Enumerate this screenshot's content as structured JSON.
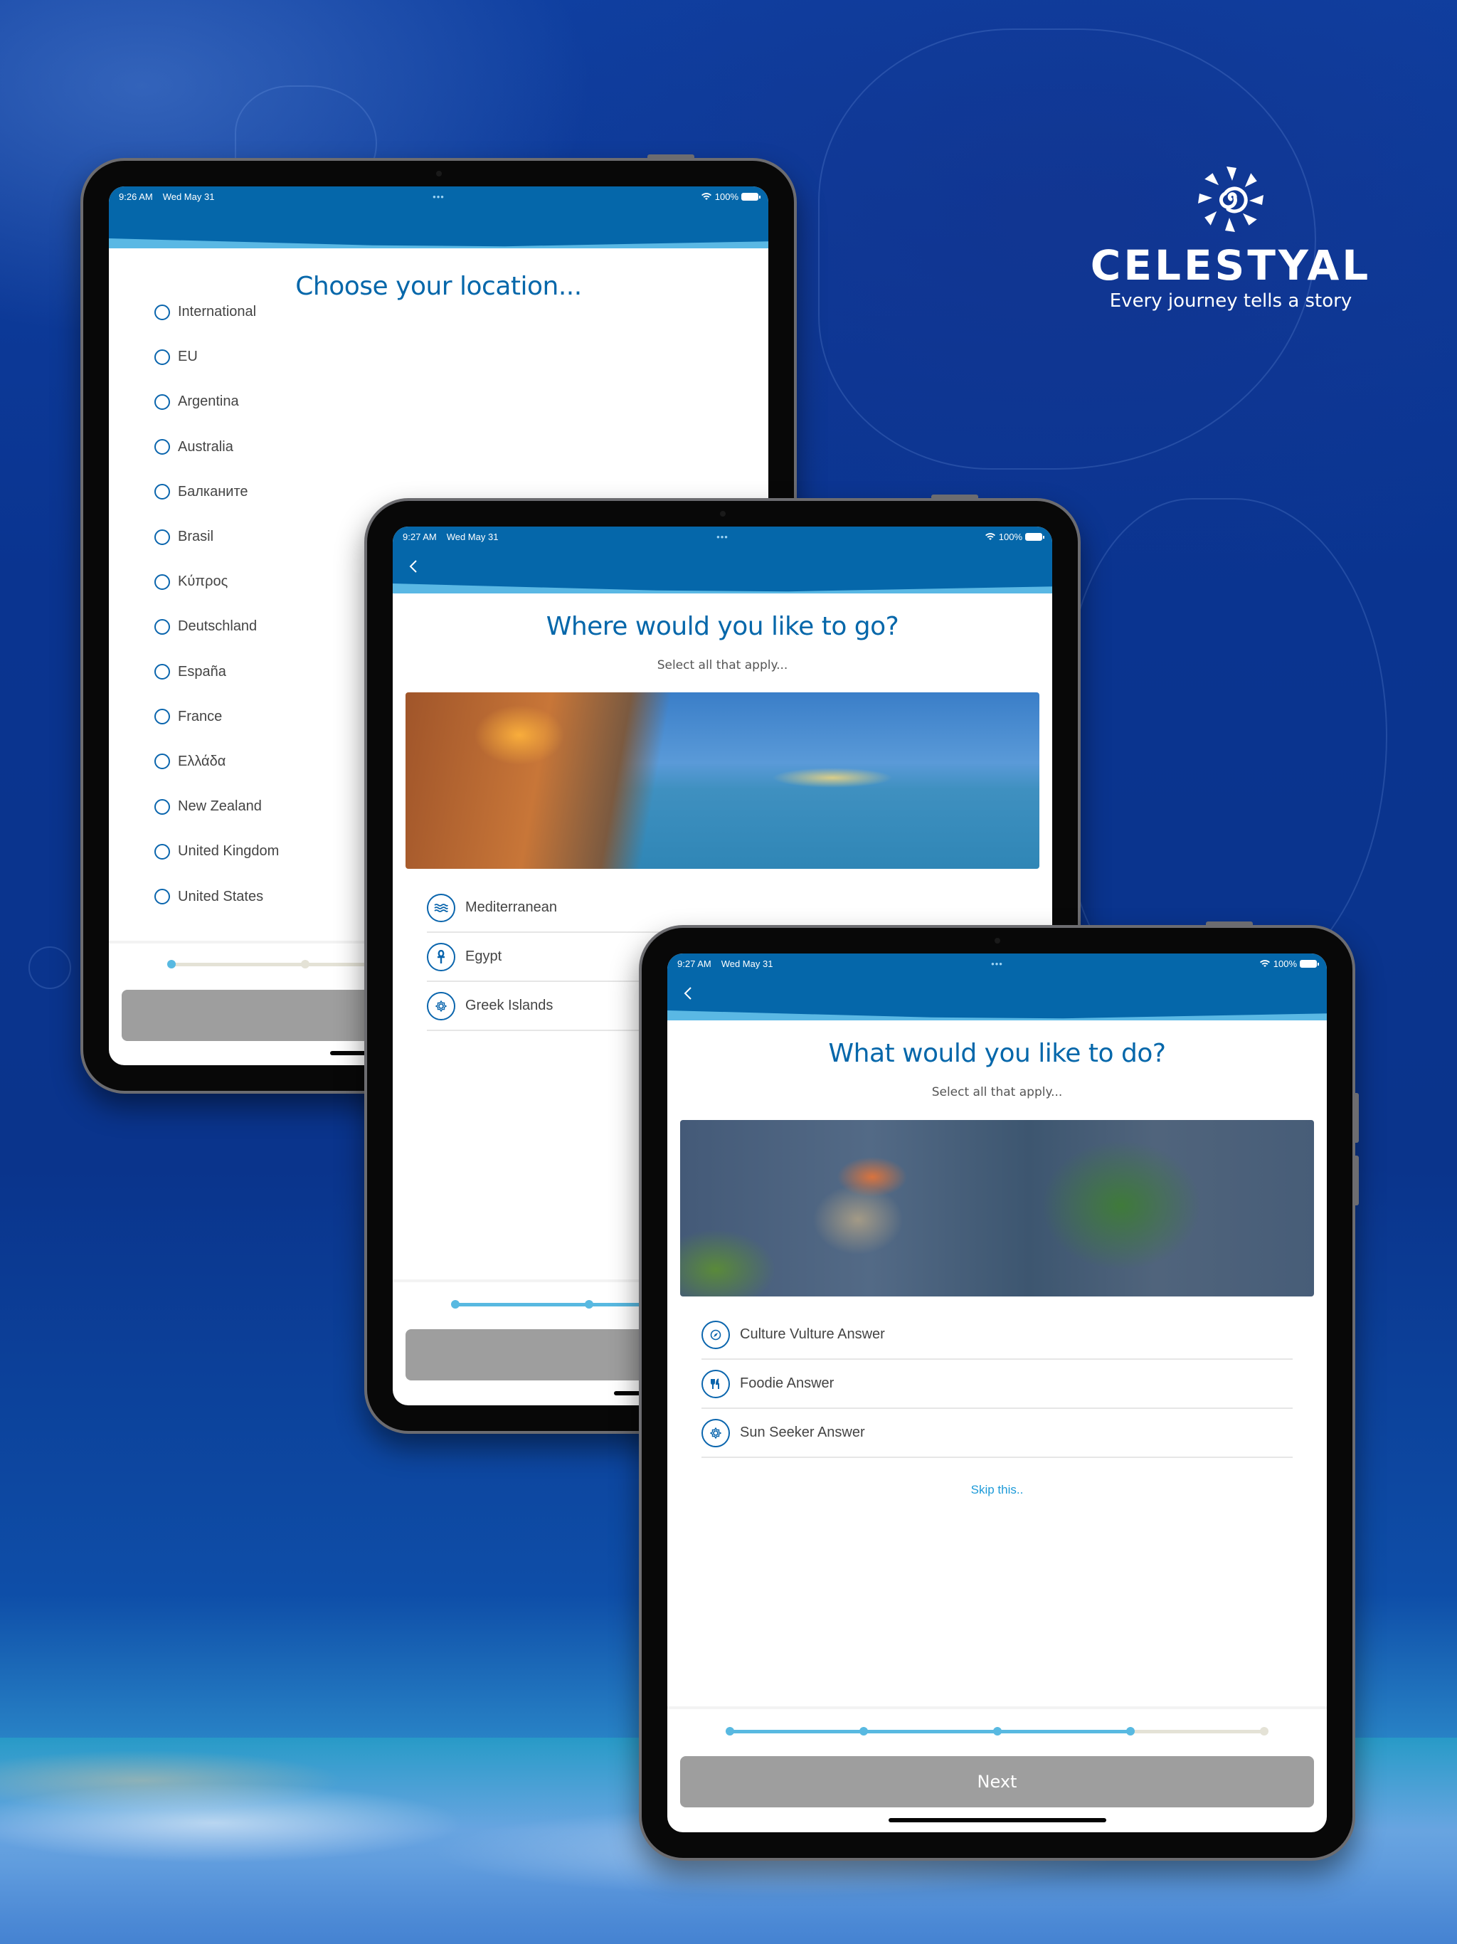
{
  "brand": {
    "name": "CELESTYAL",
    "tagline": "Every journey tells a story",
    "colors": {
      "primary": "#0567aa",
      "accent": "#58b9e1",
      "button_disabled": "#9e9e9e",
      "link": "#1d9ad8"
    }
  },
  "screens": [
    {
      "status": {
        "time": "9:26 AM",
        "date": "Wed May 31",
        "battery": "100%",
        "multitask": "•••"
      },
      "has_back": false,
      "title": "Choose your location...",
      "options": [
        {
          "label": "International"
        },
        {
          "label": "EU"
        },
        {
          "label": "Argentina"
        },
        {
          "label": "Australia"
        },
        {
          "label": "Балканите"
        },
        {
          "label": "Brasil"
        },
        {
          "label": "Κύπρος"
        },
        {
          "label": "Deutschland"
        },
        {
          "label": "España"
        },
        {
          "label": "France"
        },
        {
          "label": "Ελλάδα"
        },
        {
          "label": "New Zealand"
        },
        {
          "label": "United Kingdom"
        },
        {
          "label": "United States"
        }
      ],
      "progress": {
        "steps": 5,
        "completed": 1
      },
      "button_label": ""
    },
    {
      "status": {
        "time": "9:27 AM",
        "date": "Wed May 31",
        "battery": "100%",
        "multitask": "•••"
      },
      "has_back": true,
      "title": "Where would you like to go?",
      "subtitle": "Select all that apply...",
      "hero": "harbour-photo",
      "options": [
        {
          "label": "Mediterranean",
          "icon": "waves-icon"
        },
        {
          "label": "Egypt",
          "icon": "ankh-icon"
        },
        {
          "label": "Greek Islands",
          "icon": "sun-icon"
        }
      ],
      "progress": {
        "steps": 5,
        "completed": 3
      },
      "button_label": ""
    },
    {
      "status": {
        "time": "9:27 AM",
        "date": "Wed May 31",
        "battery": "100%",
        "multitask": "•••"
      },
      "has_back": true,
      "title": "What would you like to do?",
      "subtitle": "Select all that apply...",
      "hero": "monastery-photo",
      "options": [
        {
          "label": "Culture Vulture Answer",
          "icon": "compass-icon"
        },
        {
          "label": "Foodie Answer",
          "icon": "fork-knife-icon"
        },
        {
          "label": "Sun Seeker Answer",
          "icon": "sun-icon"
        }
      ],
      "skip_label": "Skip this..",
      "progress": {
        "steps": 5,
        "completed": 4
      },
      "button_label": "Next"
    }
  ]
}
